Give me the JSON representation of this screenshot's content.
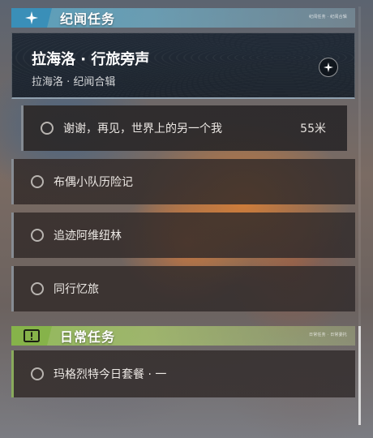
{
  "sections": {
    "jiwen": {
      "title": "纪闻任务",
      "tag": "纪闻任务 · 纪闻合辑",
      "icon": "four-point-star-icon",
      "color": "#3a8fb8"
    },
    "daily": {
      "title": "日常任务",
      "tag": "日常任务 · 日常委托",
      "icon": "exclamation-box-icon",
      "color": "#86b34a"
    }
  },
  "story": {
    "title": "拉海洛 · 行旅旁声",
    "subtitle": "拉海洛 · 纪闻合辑",
    "icon": "compass-star-icon"
  },
  "tasks": [
    {
      "label": "谢谢，再见，世界上的另一个我",
      "distance": "55米"
    },
    {
      "label": "布偶小队历险记"
    },
    {
      "label": "追迹阿维纽林"
    },
    {
      "label": "同行忆旅"
    },
    {
      "label": "玛格烈特今日套餐 · 一"
    }
  ],
  "scrollbar": {
    "position": 0.77
  }
}
